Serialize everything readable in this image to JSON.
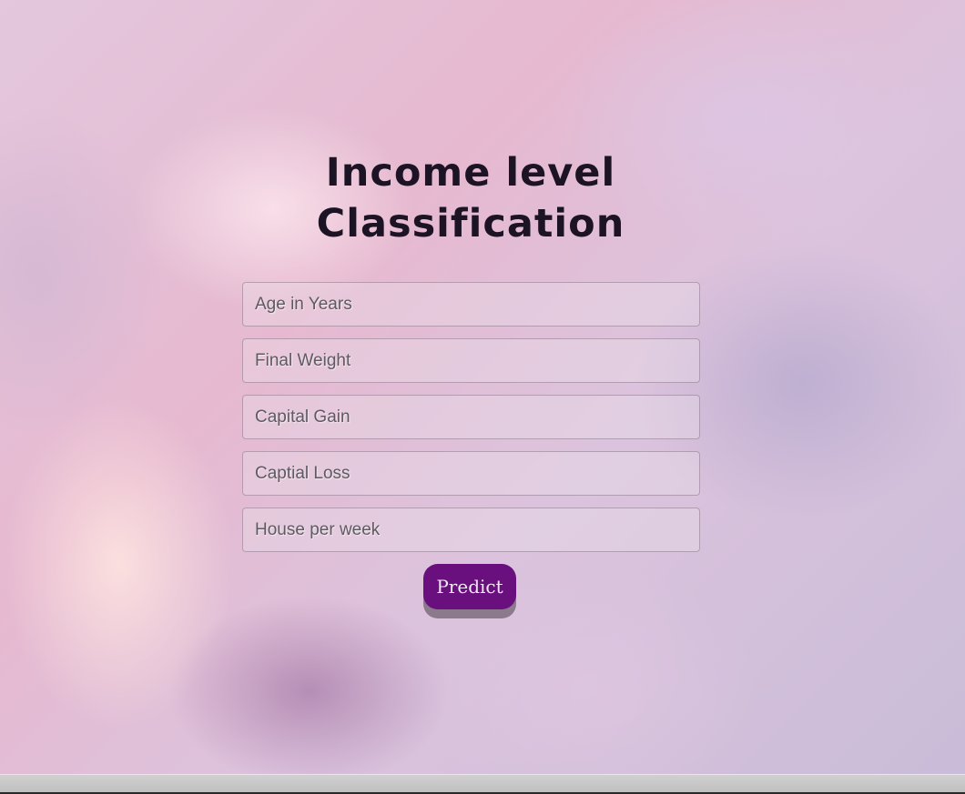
{
  "page": {
    "title_line1": "Income level",
    "title_line2": "Classification"
  },
  "form": {
    "fields": [
      {
        "placeholder": "Age in Years",
        "value": ""
      },
      {
        "placeholder": "Final Weight",
        "value": ""
      },
      {
        "placeholder": "Capital Gain",
        "value": ""
      },
      {
        "placeholder": "Captial Loss",
        "value": ""
      },
      {
        "placeholder": "House per week",
        "value": ""
      }
    ],
    "submit_label": "Predict"
  },
  "colors": {
    "button": "#6a0f7e",
    "title": "#1c1424"
  }
}
